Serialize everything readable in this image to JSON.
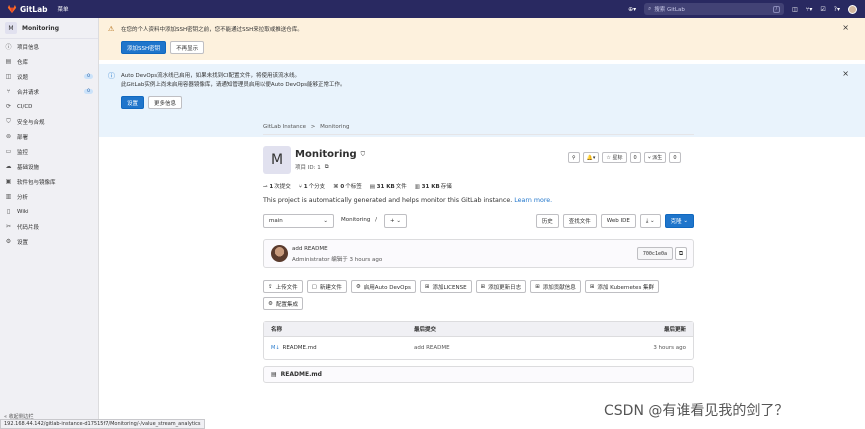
{
  "navbar": {
    "brand": "GitLab",
    "menu": "菜单",
    "search_placeholder": "搜索 GitLab",
    "search_shortcut": "/"
  },
  "sidebar": {
    "project_initial": "M",
    "project_name": "Monitoring",
    "items": [
      {
        "label": "项目信息",
        "icon": "info-icon",
        "glyph": "ⓘ"
      },
      {
        "label": "仓库",
        "icon": "repository-icon",
        "glyph": "▤"
      },
      {
        "label": "议题",
        "icon": "issues-icon",
        "glyph": "◫",
        "badge": "0"
      },
      {
        "label": "合并请求",
        "icon": "merge-request-icon",
        "glyph": "⑂",
        "badge": "0"
      },
      {
        "label": "CI/CD",
        "icon": "rocket-icon",
        "glyph": "⟳"
      },
      {
        "label": "安全与合规",
        "icon": "shield-icon",
        "glyph": "⛉"
      },
      {
        "label": "部署",
        "icon": "deploy-icon",
        "glyph": "⊚"
      },
      {
        "label": "监控",
        "icon": "monitor-icon",
        "glyph": "▭"
      },
      {
        "label": "基础设施",
        "icon": "cloud-icon",
        "glyph": "☁"
      },
      {
        "label": "软件包与镜像库",
        "icon": "package-icon",
        "glyph": "▣"
      },
      {
        "label": "分析",
        "icon": "chart-icon",
        "glyph": "▥"
      },
      {
        "label": "Wiki",
        "icon": "book-icon",
        "glyph": "▯"
      },
      {
        "label": "代码片段",
        "icon": "snippet-icon",
        "glyph": "✂"
      },
      {
        "label": "设置",
        "icon": "gear-icon",
        "glyph": "⚙"
      }
    ],
    "collapse_label": "收起侧边栏"
  },
  "alerts": {
    "ssh": {
      "text": "在您的个人资料中添加SSH密钥之前，您不能通过SSH来拉取或推送仓库。",
      "primary": "添加SSH密钥",
      "secondary": "不再显示"
    },
    "devops": {
      "line1": "Auto DevOps流水线已启用，如果未找到CI配置文件，将使用该流水线。",
      "line2": "此GitLab实例上尚未启用容器镜像库，请通知管理员启用以便Auto DevOps能够正常工作。",
      "primary": "设置",
      "secondary": "更多信息"
    }
  },
  "breadcrumb": {
    "root": "GitLab Instance",
    "separator": ">",
    "current": "Monitoring"
  },
  "project": {
    "initial": "M",
    "name": "Monitoring",
    "id_label": "项目 ID: 1",
    "star_label": "星标",
    "star_count": "0",
    "fork_label": "派生",
    "fork_count": "0",
    "description": "This project is automatically generated and helps monitor this GitLab instance.",
    "learn_more": "Learn more."
  },
  "stats": [
    {
      "value": "1",
      "label": "次提交"
    },
    {
      "value": "1",
      "label": "个分支"
    },
    {
      "value": "0",
      "label": "个标签"
    },
    {
      "value": "31 KB",
      "label": "文件"
    },
    {
      "value": "31 KB",
      "label": "存储"
    }
  ],
  "toolbar": {
    "branch": "main",
    "path": "Monitoring",
    "path_sep": "/",
    "add": "+",
    "history": "历史",
    "find_file": "查找文件",
    "web_ide": "Web IDE",
    "clone": "克隆"
  },
  "commit": {
    "title": "add README",
    "author": "Administrator",
    "meta": "编辑于 3 hours ago",
    "sha": "700c1e0a"
  },
  "quick_actions": [
    {
      "label": "上传文件",
      "icon": "upload-icon",
      "glyph": "⇪"
    },
    {
      "label": "新建文件",
      "icon": "file-plus-icon",
      "glyph": "▢"
    },
    {
      "label": "启用Auto DevOps",
      "icon": "settings-icon",
      "glyph": "⚙"
    },
    {
      "label": "添加LICENSE",
      "icon": "plus-icon",
      "glyph": "⊞"
    },
    {
      "label": "添加更新日志",
      "icon": "plus-icon",
      "glyph": "⊞"
    },
    {
      "label": "添加贡献信息",
      "icon": "plus-icon",
      "glyph": "⊞"
    },
    {
      "label": "添加 Kubernetes 集群",
      "icon": "plus-icon",
      "glyph": "⊞"
    },
    {
      "label": "配置集成",
      "icon": "settings-icon",
      "glyph": "⚙"
    }
  ],
  "files": {
    "headers": [
      "名称",
      "最后提交",
      "最后更新"
    ],
    "rows": [
      {
        "name": "README.md",
        "commit": "add README",
        "updated": "3 hours ago"
      }
    ]
  },
  "readme": {
    "title": "README.md"
  },
  "statusbar": "192.168.44.142/gitlab-instance-d17515f7/Monitoring/-/value_stream_analytics",
  "watermark": "CSDN @有谁看见我的剑了？"
}
